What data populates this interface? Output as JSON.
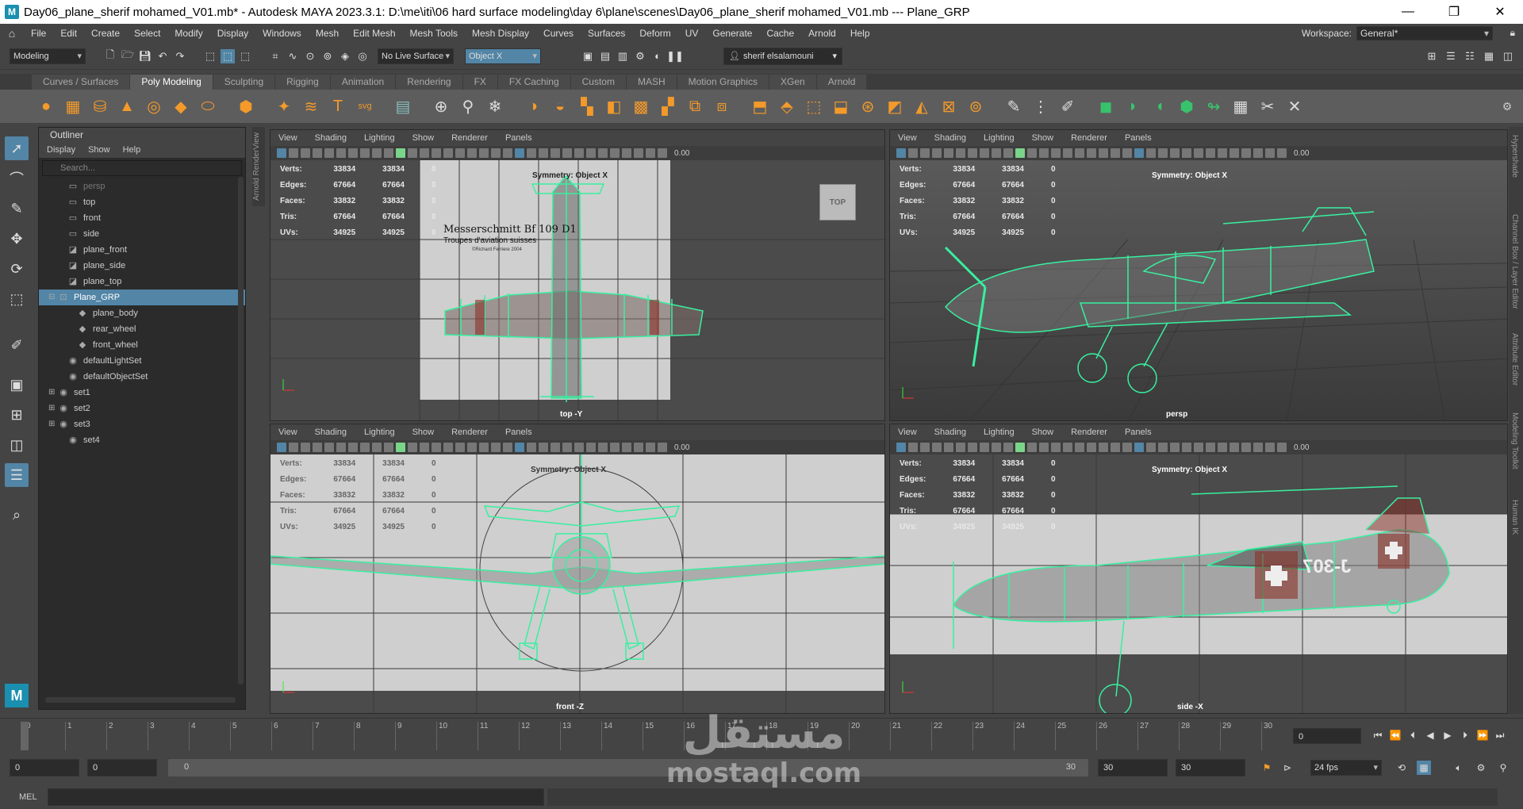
{
  "window": {
    "title": "Day06_plane_sherif mohamed_V01.mb* - Autodesk MAYA 2023.3.1: D:\\me\\iti\\06 hard surface modeling\\day 6\\plane\\scenes\\Day06_plane_sherif mohamed_V01.mb  ---   Plane_GRP",
    "app_icon": "M",
    "minimize": "—",
    "maximize": "❐",
    "close": "✕"
  },
  "menus": [
    "File",
    "Edit",
    "Create",
    "Select",
    "Modify",
    "Display",
    "Windows",
    "Mesh",
    "Edit Mesh",
    "Mesh Tools",
    "Mesh Display",
    "Curves",
    "Surfaces",
    "Deform",
    "UV",
    "Generate",
    "Cache",
    "Arnold",
    "Help"
  ],
  "workspace": {
    "label": "Workspace:",
    "value": "General*"
  },
  "status": {
    "mode": "Modeling",
    "live_surface": "No Live Surface",
    "symmetry": "Object X",
    "user": "sherif elsalamouni"
  },
  "shelf_tabs": [
    "Curves / Surfaces",
    "Poly Modeling",
    "Sculpting",
    "Rigging",
    "Animation",
    "Rendering",
    "FX",
    "FX Caching",
    "Custom",
    "MASH",
    "Motion Graphics",
    "XGen",
    "Arnold"
  ],
  "shelf_active": "Poly Modeling",
  "outliner": {
    "title": "Outliner",
    "menu": [
      "Display",
      "Show",
      "Help"
    ],
    "search_placeholder": "Search...",
    "items": [
      {
        "label": "persp",
        "icon": "camera-icon",
        "indent": 2,
        "dim": true
      },
      {
        "label": "top",
        "icon": "camera-icon",
        "indent": 2
      },
      {
        "label": "front",
        "icon": "camera-icon",
        "indent": 2
      },
      {
        "label": "side",
        "icon": "camera-icon",
        "indent": 2
      },
      {
        "label": "plane_front",
        "icon": "image-plane-icon",
        "indent": 2
      },
      {
        "label": "plane_side",
        "icon": "image-plane-icon",
        "indent": 2
      },
      {
        "label": "plane_top",
        "icon": "image-plane-icon",
        "indent": 2
      },
      {
        "label": "Plane_GRP",
        "icon": "group-icon",
        "indent": 1,
        "expander": "⊟",
        "selected": true
      },
      {
        "label": "plane_body",
        "icon": "mesh-icon",
        "indent": 3
      },
      {
        "label": "rear_wheel",
        "icon": "mesh-icon",
        "indent": 3
      },
      {
        "label": "front_wheel",
        "icon": "mesh-icon",
        "indent": 3
      },
      {
        "label": "defaultLightSet",
        "icon": "set-icon",
        "indent": 2
      },
      {
        "label": "defaultObjectSet",
        "icon": "set-icon",
        "indent": 2
      },
      {
        "label": "set1",
        "icon": "set-icon",
        "indent": 1,
        "expander": "⊞"
      },
      {
        "label": "set2",
        "icon": "set-icon",
        "indent": 1,
        "expander": "⊞"
      },
      {
        "label": "set3",
        "icon": "set-icon",
        "indent": 1,
        "expander": "⊞"
      },
      {
        "label": "set4",
        "icon": "set-icon",
        "indent": 2
      }
    ]
  },
  "side_strip_label": "Arnold RenderView",
  "right_strip_labels": [
    "Hypershade",
    "Channel Box / Layer Editor",
    "Attribute Editor",
    "Modeling Toolkit",
    "Human IK"
  ],
  "panel_menu": [
    "View",
    "Shading",
    "Lighting",
    "Show",
    "Renderer",
    "Panels"
  ],
  "hud": {
    "rows": [
      {
        "label": "Verts:",
        "a": "33834",
        "b": "33834",
        "c": "0"
      },
      {
        "label": "Edges:",
        "a": "67664",
        "b": "67664",
        "c": "0"
      },
      {
        "label": "Faces:",
        "a": "33832",
        "b": "33832",
        "c": "0"
      },
      {
        "label": "Tris:",
        "a": "67664",
        "b": "67664",
        "c": "0"
      },
      {
        "label": "UVs:",
        "a": "34925",
        "b": "34925",
        "c": "0"
      }
    ],
    "symmetry": "Symmetry: Object X",
    "zero": "0.00"
  },
  "viewports": {
    "top": {
      "camera": "top -Y",
      "cube": "TOP",
      "ref_title": "Messerschmitt Bf 109 D1",
      "ref_subtitle": "Troupes d'aviation suisses",
      "ref_credit": "©Richard Ferriere 2004"
    },
    "persp": {
      "camera": "persp"
    },
    "front": {
      "camera": "front -Z"
    },
    "side": {
      "camera": "side -X",
      "marking": "J-307"
    }
  },
  "timeline": {
    "ticks": [
      "0",
      "1",
      "2",
      "3",
      "4",
      "5",
      "6",
      "7",
      "8",
      "9",
      "10",
      "11",
      "12",
      "13",
      "14",
      "15",
      "16",
      "17",
      "18",
      "19",
      "20",
      "21",
      "22",
      "23",
      "24",
      "25",
      "26",
      "27",
      "28",
      "29",
      "30"
    ],
    "current_frame": "0",
    "current_frame_box": "0"
  },
  "range": {
    "start": "0",
    "anim_start": "0",
    "range_start": "0",
    "range_end": "30",
    "anim_end": "30",
    "end": "30",
    "fps": "24 fps"
  },
  "cmdline": {
    "label": "MEL"
  },
  "watermark": {
    "arabic": "مستقل",
    "latin": "mostaql.com"
  },
  "colors": {
    "accent": "#5285a6",
    "wire": "#38f0a0",
    "viewport_bg": "#4b4b4b",
    "ref_bg": "#cfcfcf"
  }
}
